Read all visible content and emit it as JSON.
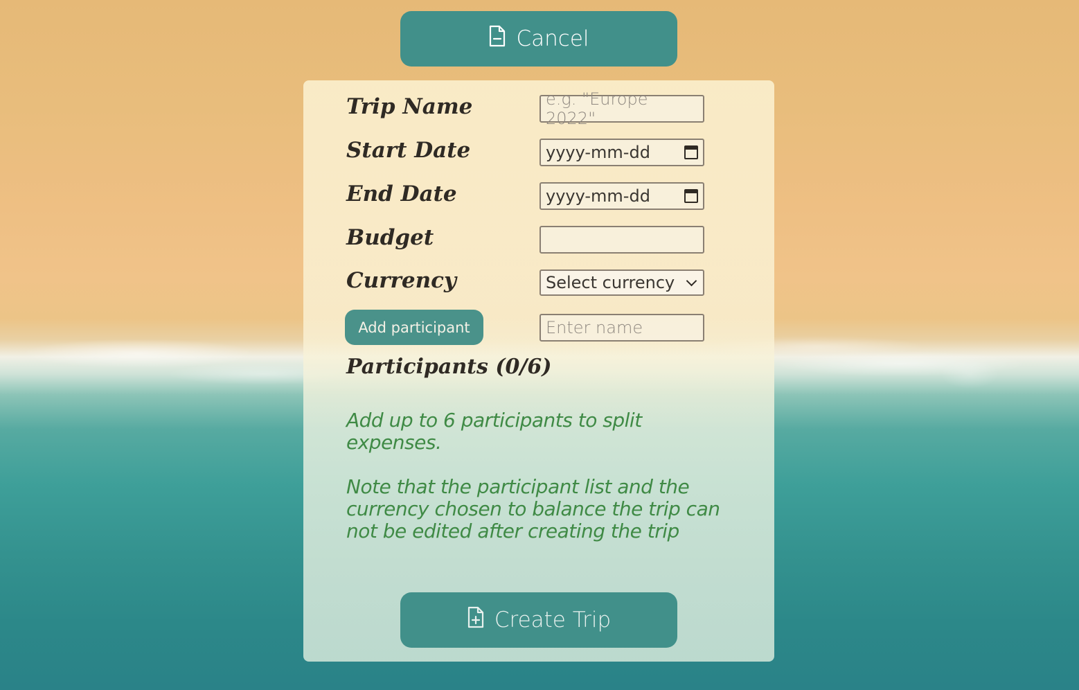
{
  "cancel_button": {
    "label": "Cancel",
    "icon": "file-minus-icon"
  },
  "form": {
    "trip_name": {
      "label": "Trip Name",
      "placeholder": "e.g. \"Europe 2022\""
    },
    "start_date": {
      "label": "Start Date",
      "placeholder": "yyyy-mm-dd",
      "icon": "calendar-icon"
    },
    "end_date": {
      "label": "End Date",
      "placeholder": "yyyy-mm-dd",
      "icon": "calendar-icon"
    },
    "budget": {
      "label": "Budget",
      "value": ""
    },
    "currency": {
      "label": "Currency",
      "selected": "Select currency",
      "icon": "chevron-down-icon"
    },
    "participant": {
      "button_label": "Add participant",
      "placeholder": "Enter name"
    }
  },
  "participants": {
    "title": "Participants (0/6)",
    "hint": "Add up to 6 participants to split expenses.",
    "note": "Note that the participant list and the currency chosen to balance the trip can not be edited after creating the trip"
  },
  "create_button": {
    "label": "Create Trip",
    "icon": "file-plus-icon"
  },
  "colors": {
    "button": "#41908a",
    "add_button": "#4a928a",
    "label_text": "#2f2a24",
    "note_text": "#3f8a45"
  }
}
